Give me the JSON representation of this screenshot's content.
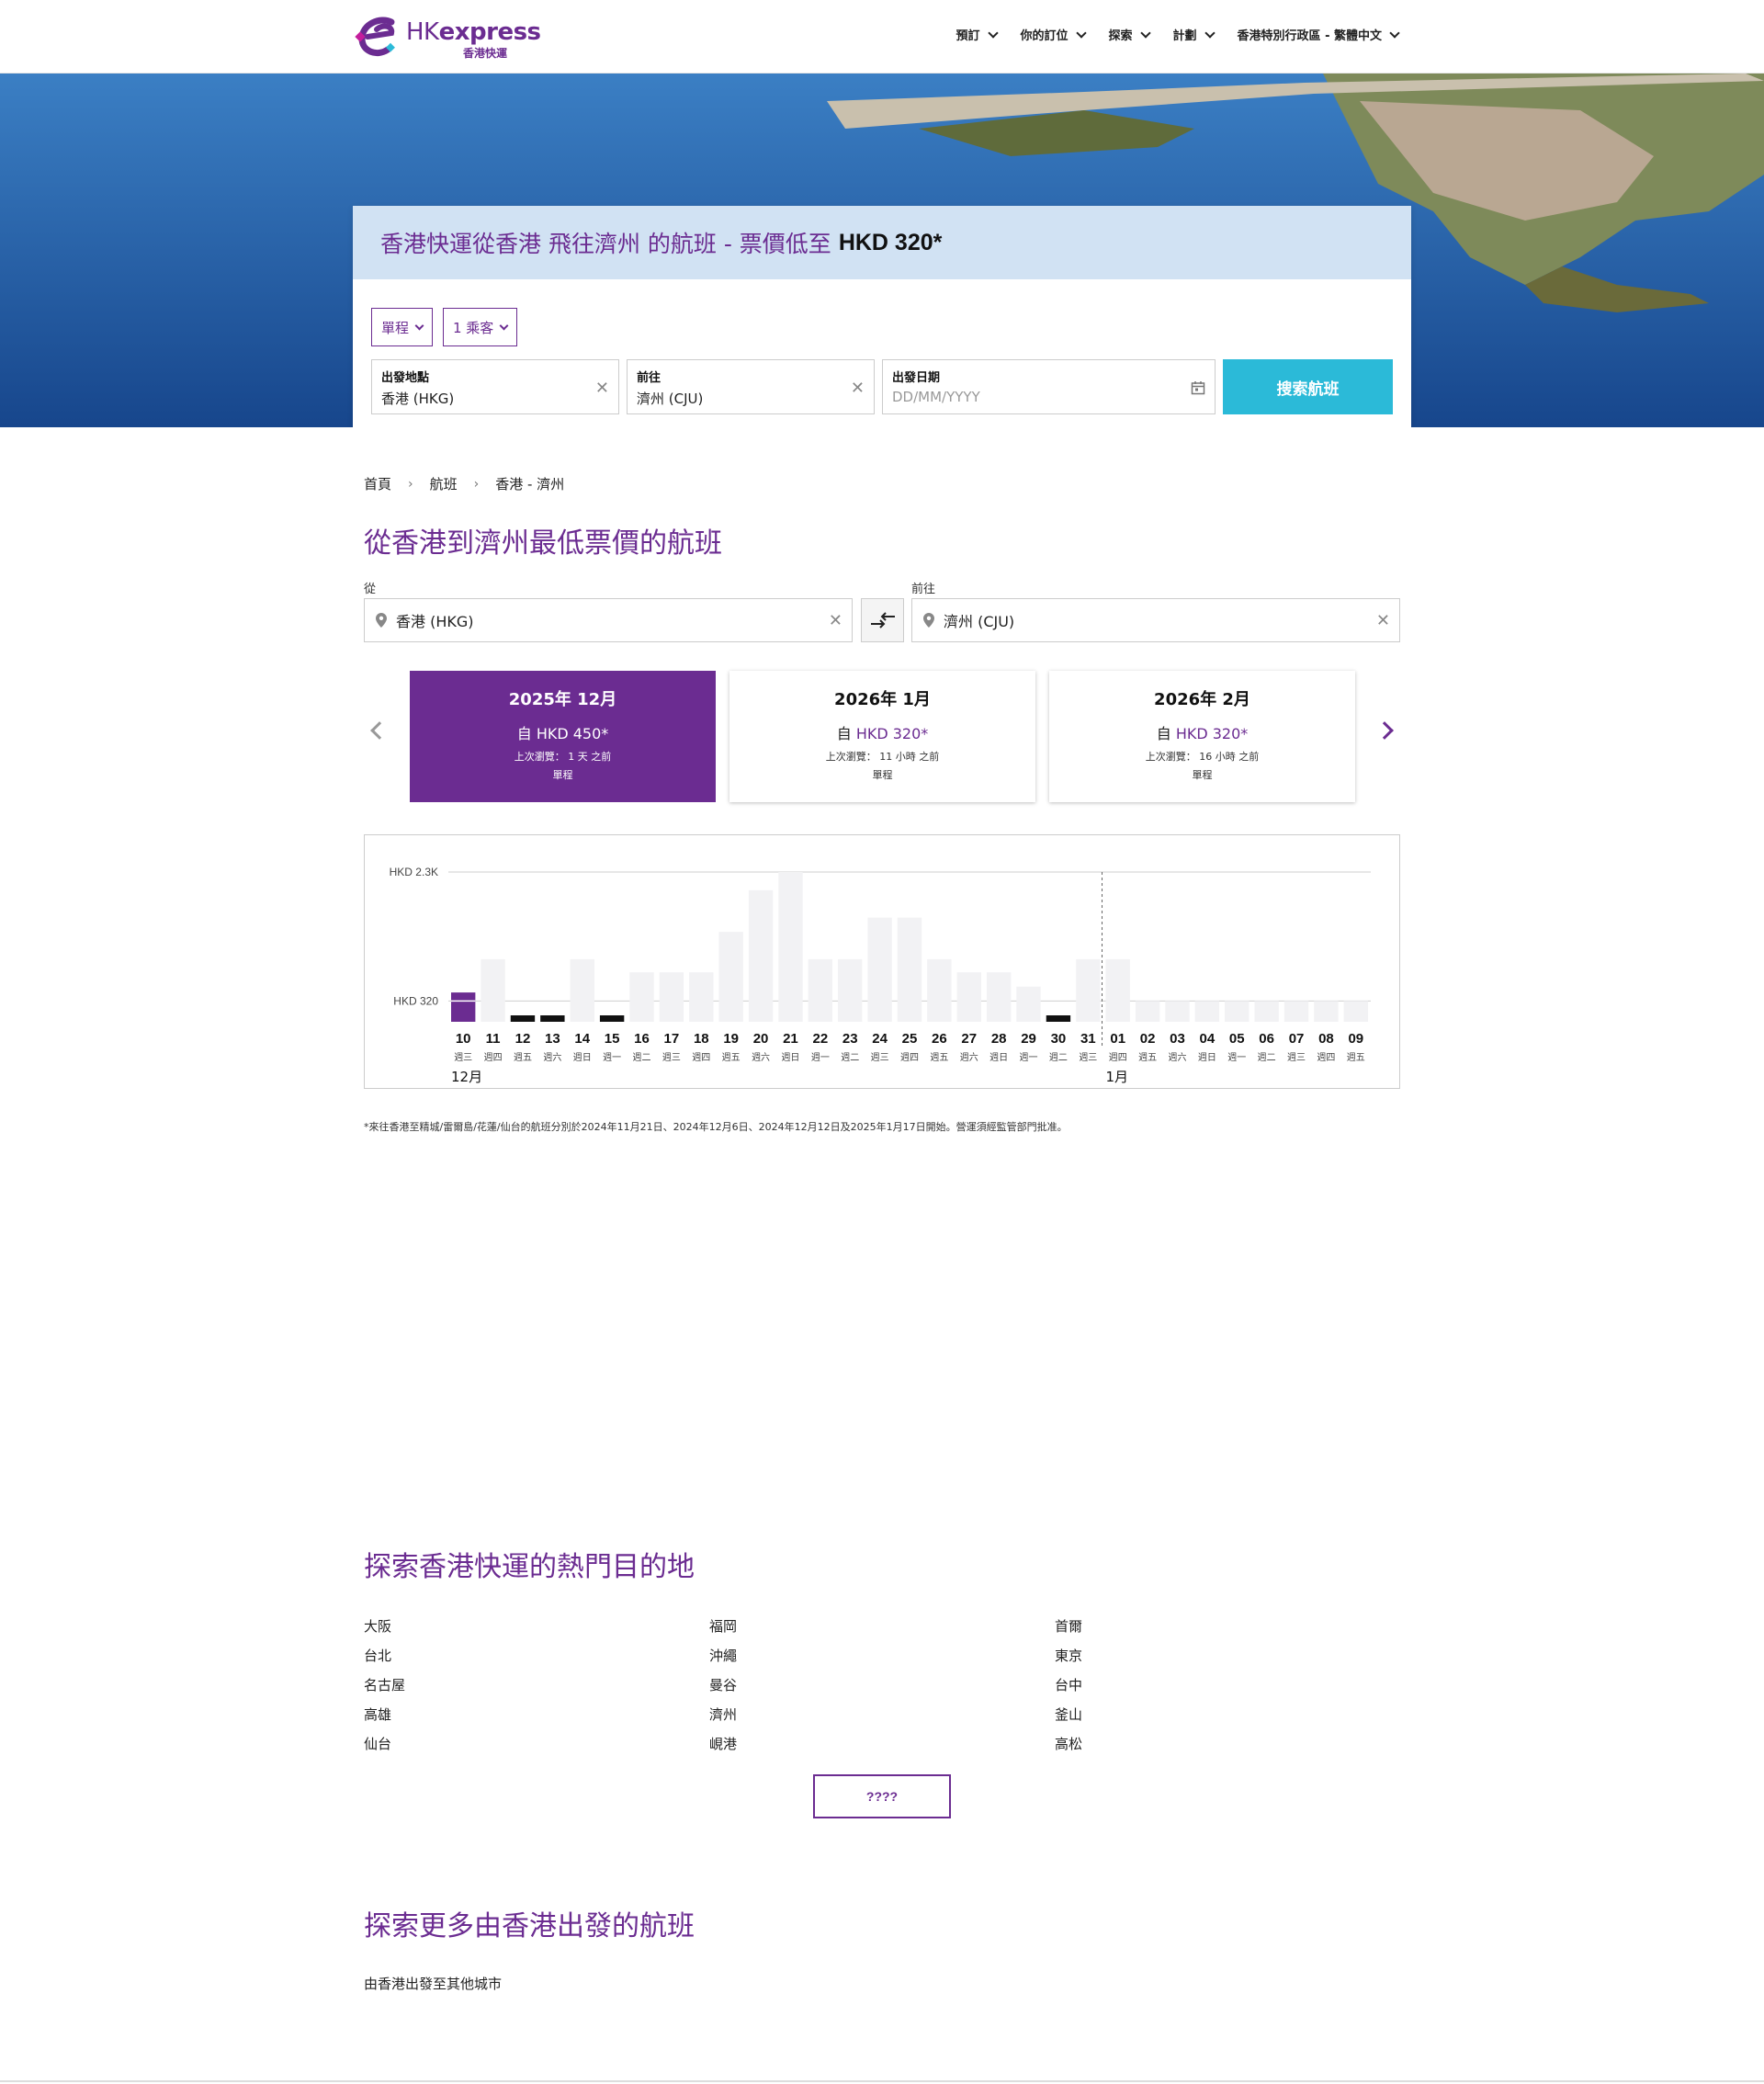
{
  "header": {
    "brand_prefix": "HK",
    "brand_name": "express",
    "brand_sub": "香港快運",
    "nav": [
      {
        "label": "預訂"
      },
      {
        "label": "你的訂位"
      },
      {
        "label": "探索"
      },
      {
        "label": "計劃"
      },
      {
        "label": "香港特別行政區 - 繁體中文"
      }
    ]
  },
  "search": {
    "heading": "香港快運從香港 飛往濟州 的航班 - 票價低至",
    "heading_price": "HKD 320*",
    "trip_type": "單程",
    "passengers": "1 乘客",
    "origin_label": "出發地點",
    "origin_value": "香港 (HKG)",
    "dest_label": "前往",
    "dest_value": "濟州 (CJU)",
    "date_label": "出發日期",
    "date_placeholder": "DD/MM/YYYY",
    "button": "搜索航班"
  },
  "breadcrumb": [
    "首頁",
    "航班",
    "香港 - 濟州"
  ],
  "page_title": "從香港到濟州最低票價的航班",
  "route": {
    "from_label": "從",
    "from_value": "香港 (HKG)",
    "to_label": "前往",
    "to_value": "濟州 (CJU)"
  },
  "months": [
    {
      "month": "2025年 12月",
      "prefix": "自",
      "price": "HKD 450*",
      "viewed": "上次瀏覽： 1 天 之前",
      "trip": "單程",
      "active": true
    },
    {
      "month": "2026年 1月",
      "prefix": "自",
      "price": "HKD 320*",
      "viewed": "上次瀏覽： 11 小時 之前",
      "trip": "單程",
      "active": false
    },
    {
      "month": "2026年 2月",
      "prefix": "自",
      "price": "HKD 320*",
      "viewed": "上次瀏覽： 16 小時 之前",
      "trip": "單程",
      "active": false
    }
  ],
  "colors": {
    "accent": "#6b2c91",
    "button": "#2bbad8",
    "bar_empty": "#f2f2f4",
    "bar_selected": "#6b2c91",
    "bar_marker": "#111111"
  },
  "chart_data": {
    "type": "bar",
    "y_labels": [
      "HKD 2.3K",
      "HKD 320"
    ],
    "y_ticks": [
      2300,
      320
    ],
    "ylim": [
      0,
      2300
    ],
    "categories": [
      "10",
      "11",
      "12",
      "13",
      "14",
      "15",
      "16",
      "17",
      "18",
      "19",
      "20",
      "21",
      "22",
      "23",
      "24",
      "25",
      "26",
      "27",
      "28",
      "29",
      "30",
      "31",
      "01",
      "02",
      "03",
      "04",
      "05",
      "06",
      "07",
      "08",
      "09"
    ],
    "weekdays": [
      "週三",
      "週四",
      "週五",
      "週六",
      "週日",
      "週一",
      "週二",
      "週三",
      "週四",
      "週五",
      "週六",
      "週日",
      "週一",
      "週二",
      "週三",
      "週四",
      "週五",
      "週六",
      "週日",
      "週一",
      "週二",
      "週三",
      "週四",
      "週五",
      "週六",
      "週日",
      "週一",
      "週二",
      "週三",
      "週四",
      "週五"
    ],
    "month_labels": [
      {
        "index": 0,
        "label": "12月"
      },
      {
        "index": 22,
        "label": "1月"
      }
    ],
    "values": [
      450,
      960,
      120,
      120,
      960,
      120,
      760,
      760,
      760,
      1380,
      2020,
      2300,
      960,
      960,
      1600,
      1600,
      960,
      760,
      760,
      540,
      120,
      960,
      960,
      320,
      320,
      320,
      320,
      320,
      320,
      320,
      320
    ],
    "markers": [
      2,
      3,
      5,
      20
    ],
    "selected": 0,
    "divider_index": 22
  },
  "footnote": "*來往香港至精城/雷爾島/花蓮/仙台的航班分別於2024年11月21日、2024年12月6日、2024年12月12日及2025年1月17日開始。營運須經監管部門批准。",
  "popular": {
    "title": "探索香港快運的熱門目的地",
    "columns": [
      [
        "大阪",
        "台北",
        "名古屋",
        "高雄",
        "仙台"
      ],
      [
        "福岡",
        "沖繩",
        "曼谷",
        "濟州",
        "峴港"
      ],
      [
        "首爾",
        "東京",
        "台中",
        "釜山",
        "高松"
      ]
    ],
    "more_button": "????"
  },
  "more_flights": {
    "title": "探索更多由香港出發的航班",
    "link": "由香港出發至其他城市"
  }
}
